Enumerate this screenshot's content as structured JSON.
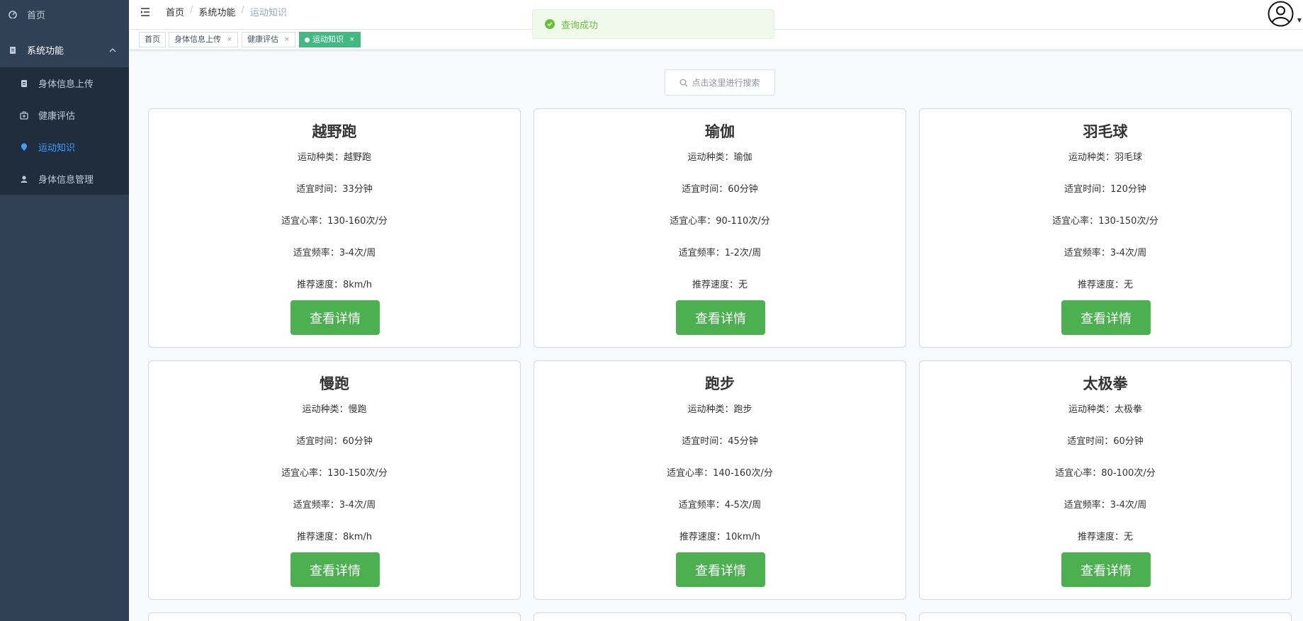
{
  "sidebar": {
    "home": "首页",
    "system": "系统功能",
    "items": [
      {
        "label": "身体信息上传"
      },
      {
        "label": "健康评估"
      },
      {
        "label": "运动知识"
      },
      {
        "label": "身体信息管理"
      }
    ]
  },
  "header": {
    "breadcrumb": [
      "首页",
      "系统功能",
      "运动知识"
    ]
  },
  "tags": [
    {
      "label": "首页"
    },
    {
      "label": "身体信息上传"
    },
    {
      "label": "健康评估"
    },
    {
      "label": "运动知识"
    }
  ],
  "toast": {
    "message": "查询成功"
  },
  "search": {
    "placeholder": "点击这里进行搜索"
  },
  "cards": [
    {
      "title": "越野跑",
      "type": "运动种类：越野跑",
      "time": "适宜时间：33分钟",
      "heart": "适宜心率：130-160次/分",
      "freq": "适宜频率：3-4次/周",
      "speed": "推荐速度：8km/h",
      "button": "查看详情"
    },
    {
      "title": "瑜伽",
      "type": "运动种类：瑜伽",
      "time": "适宜时间：60分钟",
      "heart": "适宜心率：90-110次/分",
      "freq": "适宜频率：1-2次/周",
      "speed": "推荐速度：无",
      "button": "查看详情"
    },
    {
      "title": "羽毛球",
      "type": "运动种类：羽毛球",
      "time": "适宜时间：120分钟",
      "heart": "适宜心率：130-150次/分",
      "freq": "适宜频率：3-4次/周",
      "speed": "推荐速度：无",
      "button": "查看详情"
    },
    {
      "title": "慢跑",
      "type": "运动种类：慢跑",
      "time": "适宜时间：60分钟",
      "heart": "适宜心率：130-150次/分",
      "freq": "适宜频率：3-4次/周",
      "speed": "推荐速度：8km/h",
      "button": "查看详情"
    },
    {
      "title": "跑步",
      "type": "运动种类：跑步",
      "time": "适宜时间：45分钟",
      "heart": "适宜心率：140-160次/分",
      "freq": "适宜频率：4-5次/周",
      "speed": "推荐速度：10km/h",
      "button": "查看详情"
    },
    {
      "title": "太极拳",
      "type": "运动种类：太极拳",
      "time": "适宜时间：60分钟",
      "heart": "适宜心率：80-100次/分",
      "freq": "适宜频率：3-4次/周",
      "speed": "推荐速度：无",
      "button": "查看详情"
    }
  ],
  "icons": {
    "dashboard": "dashboard-icon",
    "system": "document-icon",
    "upload": "document-icon",
    "health": "medical-box-icon",
    "knowledge": "location-pin-icon",
    "manage": "user-icon",
    "hamburger": "hamburger-icon",
    "avatar": "user-avatar-icon",
    "search": "search-icon",
    "success": "check-circle-icon"
  },
  "colors": {
    "sidebar_bg": "#304156",
    "submenu_bg": "#1f2d3d",
    "active_menu": "#409eff",
    "active_tag": "#42b983",
    "button": "#4caf50",
    "toast_text": "#67c23a"
  }
}
